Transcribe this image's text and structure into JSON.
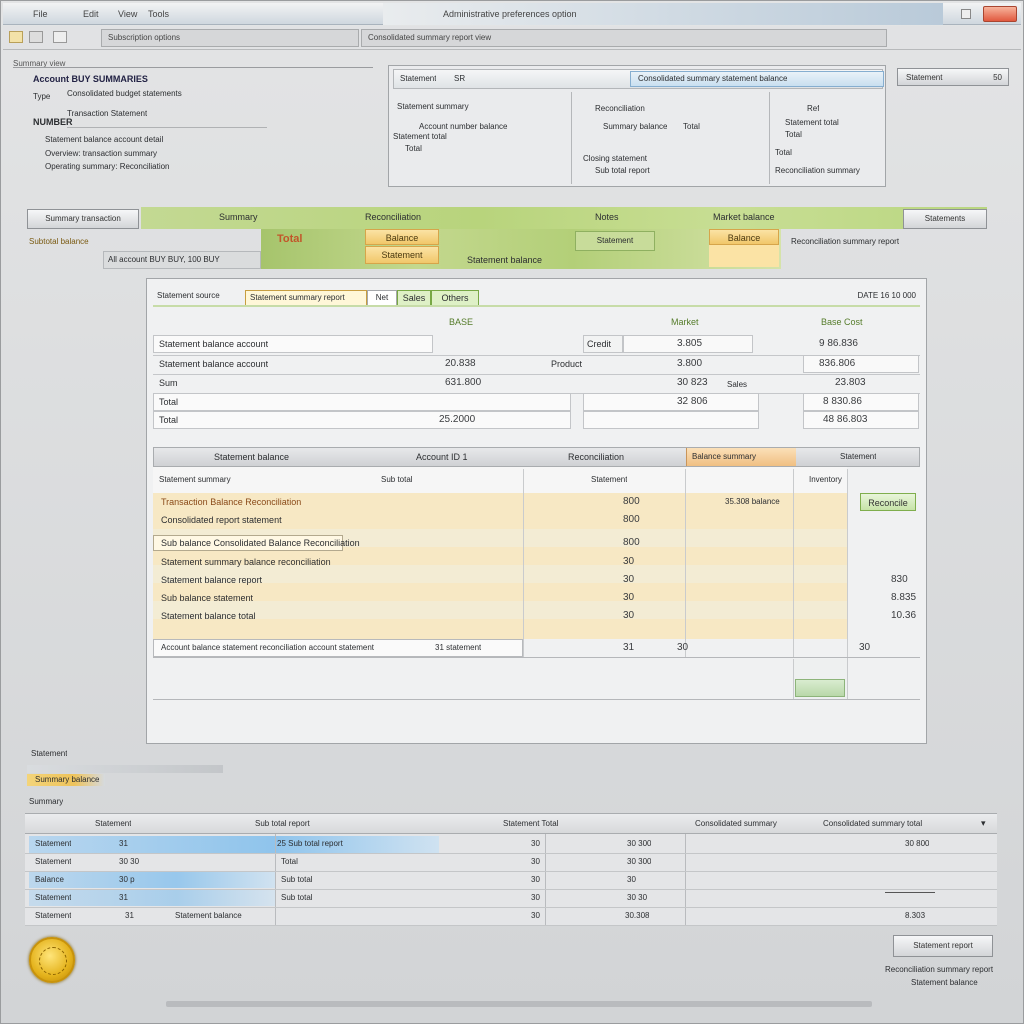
{
  "window": {
    "title": "Administrative preferences option",
    "app_menu": [
      "File",
      "Edit",
      "View",
      "Tools"
    ],
    "colors": {
      "titlebar": "#cfd7df",
      "close": "#e1593f",
      "accent_green": "#b8d47c",
      "accent_orange": "#f1c76a",
      "selection_blue": "#8fc4ec"
    }
  },
  "toolbar": {
    "field_left": "Subscription options",
    "field_right": "Consolidated summary report view"
  },
  "top_left_panel": {
    "header": "Summary view",
    "title": "Account BUY SUMMARIES",
    "row1_label": "Type",
    "row1_value": "Consolidated budget statements",
    "row2_label": "NUMBER",
    "row2_value": "Transaction Statement",
    "desc1": "Statement balance account detail",
    "desc2": "Overview: transaction summary",
    "desc3": "Operating summary: Reconciliation"
  },
  "top_right_panel": {
    "tab_left": "Statement",
    "tab_mid": "SR",
    "tab_title": "Consolidated summary statement balance",
    "side_button": "Statement",
    "side_value": "50",
    "left_head": "Statement summary",
    "left_row1": "Account number balance",
    "left_row2": "Statement total",
    "left_row3": "Total",
    "mid_head": "Reconciliation",
    "mid_row1": "Summary balance",
    "mid_row1_val": "Total",
    "mid_row2": "Closing statement",
    "mid_row3": "Sub total report",
    "right_head": "Ref",
    "right_row1": "Statement total",
    "right_row2": "Total",
    "right_row3": "Total",
    "right_row4": "Reconciliation summary"
  },
  "band": {
    "left_label": "Summary transaction",
    "left_label2": "Subtotal balance",
    "left_label3": "All account BUY BUY, 100 BUY",
    "chip_green": "Statement",
    "col1_head": "Summary",
    "col2_head": "Reconciliation",
    "col3_head": "Notes",
    "col4_head": "Market balance",
    "orange1": "Balance",
    "orange1b": "Statement",
    "orange2": "Balance",
    "val_red": "Total",
    "val_mid": "Statement balance",
    "right_btn": "Statements",
    "right_text": "Reconciliation summary report"
  },
  "main": {
    "header_label": "Statement source",
    "tabs": [
      "Statement summary report",
      "Net",
      "Sales",
      "Others"
    ],
    "header_right": "DATE 16 10 000",
    "col_heads": [
      "BASE",
      "Market",
      "Base Cost"
    ],
    "summary_rows": [
      {
        "label": "Statement balance account",
        "v1": "",
        "mid_label": "Credit",
        "v2": "3.805",
        "v3": "9 86.836"
      },
      {
        "label": "Statement balance account",
        "v1": "20.838",
        "mid_label": "Product",
        "v2": "3.800",
        "v3": "836.806"
      },
      {
        "label": "Sum",
        "v1": "631.800",
        "mid_label": "Sales",
        "v2": "30 823",
        "v3": "23.803"
      },
      {
        "label": "Total",
        "v1": "",
        "mid_label": "",
        "v2": "32 806",
        "v3": "8 830.86"
      },
      {
        "label": "Total",
        "v1": "25.2000",
        "mid_label": "",
        "v2": "",
        "v3": "48 86.803"
      }
    ],
    "grid_heads": [
      "Statement balance",
      "Account ID 1",
      "Reconciliation",
      "Balance summary",
      "Statement"
    ],
    "sub_heads": [
      "Statement summary",
      "Sub total",
      "Statement",
      "Inventory"
    ],
    "rows": [
      {
        "c1": "Transaction Balance Reconciliation",
        "c2": "",
        "c3": "800",
        "c4": "35.308 balance",
        "c5": "Reconciled"
      },
      {
        "c1": "Consolidated report statement",
        "c2": "",
        "c3": "800",
        "c4": "",
        "c5": ""
      },
      {
        "c1": "Sub balance Consolidated Balance Reconciliation",
        "c2": "",
        "c3": "800",
        "c4": "",
        "c5": ""
      },
      {
        "c1": "Statement summary balance reconciliation",
        "c2": "",
        "c3": "30",
        "c4": "",
        "c5": ""
      },
      {
        "c1": "Statement balance report",
        "c2": "",
        "c3": "30",
        "c4": "",
        "c5": "830"
      },
      {
        "c1": "Sub balance statement",
        "c2": "",
        "c3": "30",
        "c4": "",
        "c5": "8.835"
      },
      {
        "c1": "Statement balance total",
        "c2": "",
        "c3": "30",
        "c4": "",
        "c5": "10.36"
      },
      {
        "c1": "Account balance statement reconciliation account statement",
        "c2": "31 statement",
        "c3": "31",
        "c4": "30",
        "c5": "30"
      }
    ],
    "action_button": "Reconcile"
  },
  "lower": {
    "label1": "Statement",
    "label2": "Summary balance",
    "label3": "Summary",
    "grid_heads": [
      "Statement",
      "Sub total report",
      "Statement Total",
      "Consolidated summary",
      "Consolidated summary total"
    ],
    "rows": [
      {
        "a": "Statement",
        "b": "31",
        "c": "25 Sub total report",
        "d": "30",
        "e": "30 300",
        "f": "30 800"
      },
      {
        "a": "Statement",
        "b": "30 30",
        "c": "Total",
        "d": "30",
        "e": "30 300",
        "f": ""
      },
      {
        "a": "Balance",
        "b": "30 p",
        "c": "Sub total",
        "d": "30",
        "e": "30",
        "f": ""
      },
      {
        "a": "Statement",
        "b": "31",
        "c": "Sub total",
        "d": "30",
        "e": "30 30",
        "f": ""
      },
      {
        "a": "Statement",
        "b": "31",
        "c": "Statement balance",
        "d": "30",
        "e": "30.308",
        "f": "8.303"
      }
    ],
    "footer_button": "Statement report",
    "footer_text1": "Reconciliation summary report",
    "footer_text2": "Statement balance"
  }
}
